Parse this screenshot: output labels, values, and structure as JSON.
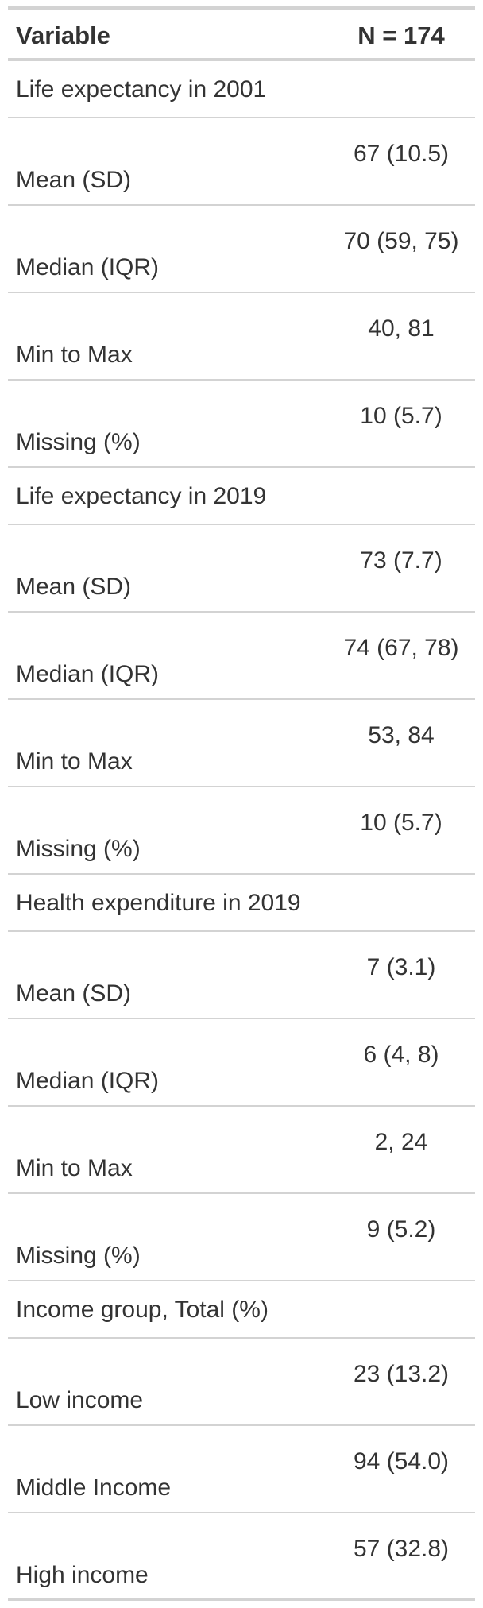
{
  "header": {
    "variable_label": "Variable",
    "n_label": "N = 174"
  },
  "groups": [
    {
      "label": "Life expectancy in 2001",
      "rows": [
        {
          "label": "Mean (SD)",
          "value": "67 (10.5)"
        },
        {
          "label": "Median (IQR)",
          "value": "70 (59, 75)"
        },
        {
          "label": "Min to Max",
          "value": "40, 81"
        },
        {
          "label": "Missing (%)",
          "value": "10 (5.7)"
        }
      ]
    },
    {
      "label": "Life expectancy in 2019",
      "rows": [
        {
          "label": "Mean (SD)",
          "value": "73 (7.7)"
        },
        {
          "label": "Median (IQR)",
          "value": "74 (67, 78)"
        },
        {
          "label": "Min to Max",
          "value": "53, 84"
        },
        {
          "label": "Missing (%)",
          "value": "10 (5.7)"
        }
      ]
    },
    {
      "label": "Health expenditure in 2019",
      "rows": [
        {
          "label": "Mean (SD)",
          "value": "7 (3.1)"
        },
        {
          "label": "Median (IQR)",
          "value": "6 (4, 8)"
        },
        {
          "label": "Min to Max",
          "value": "2, 24"
        },
        {
          "label": "Missing (%)",
          "value": "9 (5.2)"
        }
      ]
    },
    {
      "label": "Income group, Total (%)",
      "rows": [
        {
          "label": "Low income",
          "value": "23 (13.2)"
        },
        {
          "label": "Middle Income",
          "value": "94 (54.0)"
        },
        {
          "label": "High income",
          "value": "57 (32.8)"
        }
      ]
    }
  ]
}
